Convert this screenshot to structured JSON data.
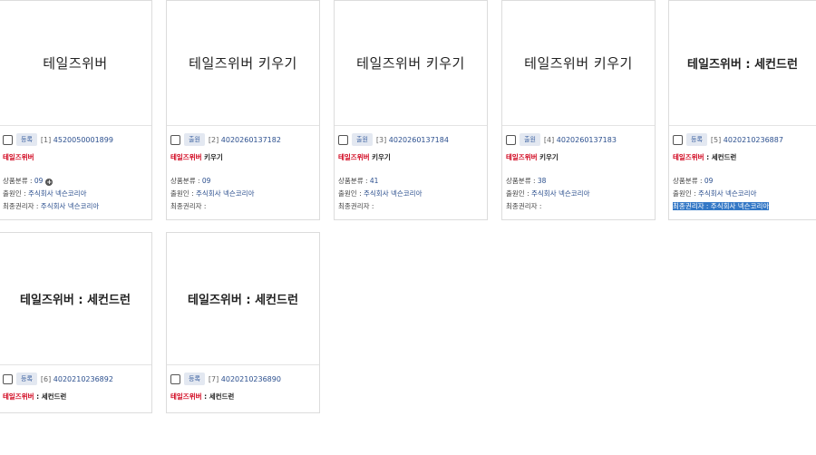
{
  "cards": [
    {
      "thumb_text": "테일즈위버",
      "badge": "등록",
      "index": "[1]",
      "app_number": "4520050001899",
      "title_red": "테일즈위버",
      "title_black": "",
      "class_label": "상품분류 : ",
      "class_value": "09",
      "applicant_label": "출원인 : ",
      "applicant_value": "주식회사 넥슨코리아",
      "owner_label": "최종권리자 : ",
      "owner_value": "주식회사 넥슨코리아"
    },
    {
      "thumb_text": "테일즈위버 키우기",
      "badge": "출원",
      "index": "[2]",
      "app_number": "4020260137182",
      "title_red": "테일즈위버",
      "title_black": "키우기",
      "class_label": "상품분류 : ",
      "class_value": "09",
      "applicant_label": "출원인 : ",
      "applicant_value": "주식회사 넥슨코리아",
      "owner_label": "최종권리자 : ",
      "owner_value": ""
    },
    {
      "thumb_text": "테일즈위버 키우기",
      "badge": "출원",
      "index": "[3]",
      "app_number": "4020260137184",
      "title_red": "테일즈위버",
      "title_black": "키우기",
      "class_label": "상품분류 : ",
      "class_value": "41",
      "applicant_label": "출원인 : ",
      "applicant_value": "주식회사 넥슨코리아",
      "owner_label": "최종권리자 : ",
      "owner_value": ""
    },
    {
      "thumb_text": "테일즈위버 키우기",
      "badge": "출원",
      "index": "[4]",
      "app_number": "4020260137183",
      "title_red": "테일즈위버",
      "title_black": "키우기",
      "class_label": "상품분류 : ",
      "class_value": "38",
      "applicant_label": "출원인 : ",
      "applicant_value": "주식회사 넥슨코리아",
      "owner_label": "최종권리자 : ",
      "owner_value": ""
    },
    {
      "thumb_text": "테일즈위버 : 세컨드런",
      "badge": "등록",
      "index": "[5]",
      "app_number": "4020210236887",
      "title_red": "테일즈위버",
      "title_black": ": 세컨드런",
      "class_label": "상품분류 : ",
      "class_value": "09",
      "applicant_label": "출원인 : ",
      "applicant_value": "주식회사 넥슨코리아",
      "owner_label": "최종권리자 : ",
      "owner_value": "주식회사 넥슨코리아"
    },
    {
      "thumb_text": "테일즈위버 : 세컨드런",
      "badge": "등록",
      "index": "[6]",
      "app_number": "4020210236892",
      "title_red": "테일즈위버",
      "title_black": ": 세컨드런"
    },
    {
      "thumb_text": "테일즈위버 : 세컨드런",
      "badge": "등록",
      "index": "[7]",
      "app_number": "4020210236890",
      "title_red": "테일즈위버",
      "title_black": ": 세컨드런"
    }
  ]
}
